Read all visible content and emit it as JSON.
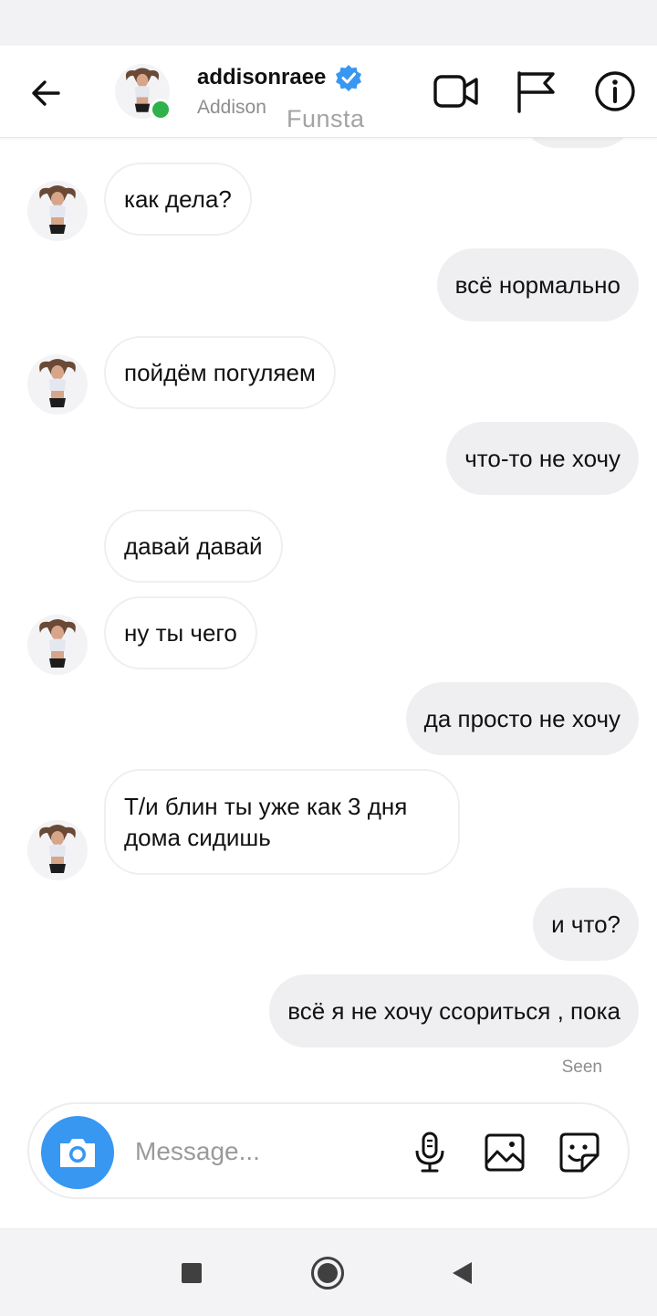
{
  "header": {
    "username": "addisonraee",
    "subname": "Addison",
    "overlay_label": "Funsta"
  },
  "messages": [
    {
      "side": "in",
      "text": "как дела?",
      "avatar": true
    },
    {
      "side": "out",
      "text": "всё нормально"
    },
    {
      "side": "in",
      "text": "пойдём погуляем",
      "avatar": true
    },
    {
      "side": "out",
      "text": "что-то не хочу"
    },
    {
      "side": "in",
      "text": "давай давай",
      "avatar": false
    },
    {
      "side": "in",
      "text": "ну ты чего",
      "avatar": true
    },
    {
      "side": "out",
      "text": "да просто не хочу"
    },
    {
      "side": "in",
      "text": "Т/и блин ты уже как 3 дня дома сидишь",
      "avatar": true
    },
    {
      "side": "out",
      "text": "и что?"
    },
    {
      "side": "out",
      "text": "всё я не хочу ссориться , пока"
    }
  ],
  "seen_label": "Seen",
  "composer": {
    "placeholder": "Message..."
  },
  "colors": {
    "accent": "#3897f0",
    "online": "#2fb14b",
    "verified": "#3897f0",
    "outgoing_bubble": "#efeff1"
  },
  "icons": [
    "back-arrow-icon",
    "verified-badge-icon",
    "video-call-icon",
    "flag-icon",
    "info-icon",
    "camera-icon",
    "microphone-icon",
    "gallery-icon",
    "sticker-icon",
    "nav-square-icon",
    "nav-home-icon",
    "nav-back-icon"
  ]
}
